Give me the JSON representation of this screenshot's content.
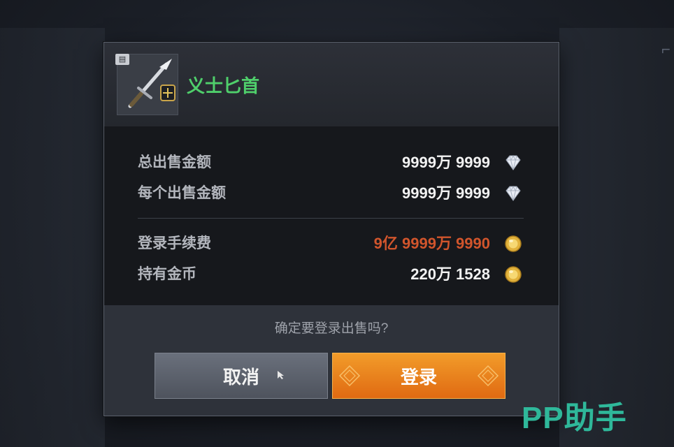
{
  "item": {
    "name": "义士匕首",
    "name_color": "#4fcf6b",
    "icon": "dagger-icon",
    "badge_icon": "book-icon"
  },
  "summary": {
    "total_label": "总出售金额",
    "total_value": "9999万 9999",
    "total_currency_icon": "diamond-icon",
    "each_label": "每个出售金额",
    "each_value": "9999万 9999",
    "each_currency_icon": "diamond-icon",
    "fee_label": "登录手续费",
    "fee_value": "9亿 9999万 9990",
    "fee_color": "#d1552c",
    "fee_currency_icon": "gold-coin-icon",
    "gold_label": "持有金币",
    "gold_value": "220万 1528",
    "gold_currency_icon": "gold-coin-icon"
  },
  "confirm_text": "确定要登录出售吗?",
  "buttons": {
    "cancel": "取消",
    "login": "登录",
    "login_color": "#e9801c"
  },
  "watermark": "PP助手"
}
